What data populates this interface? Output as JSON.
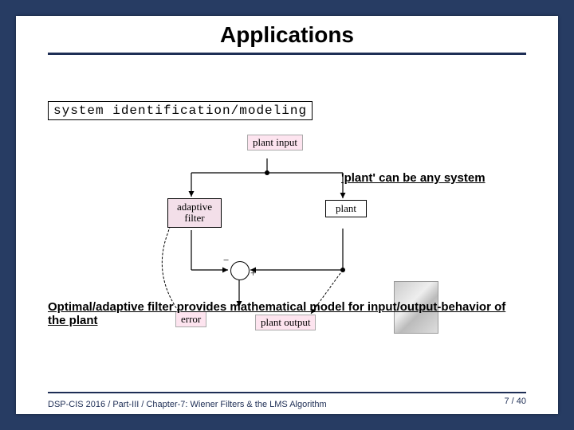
{
  "title": "Applications",
  "box_heading": "system identification/modeling",
  "labels": {
    "plant_input": "plant input",
    "adaptive_filter": "adaptive\nfilter",
    "plant": "plant",
    "error": "error",
    "plant_output": "plant output"
  },
  "signs": {
    "minus": "−",
    "plus": "+"
  },
  "annotation": "'plant' can be any system",
  "summary": "Optimal/adaptive filter provides mathematical model for input/output-behavior of the plant",
  "footer": {
    "text": "DSP-CIS 2016  /  Part-III /  Chapter-7: Wiener Filters & the LMS Algorithm",
    "page": "7 / 40"
  }
}
